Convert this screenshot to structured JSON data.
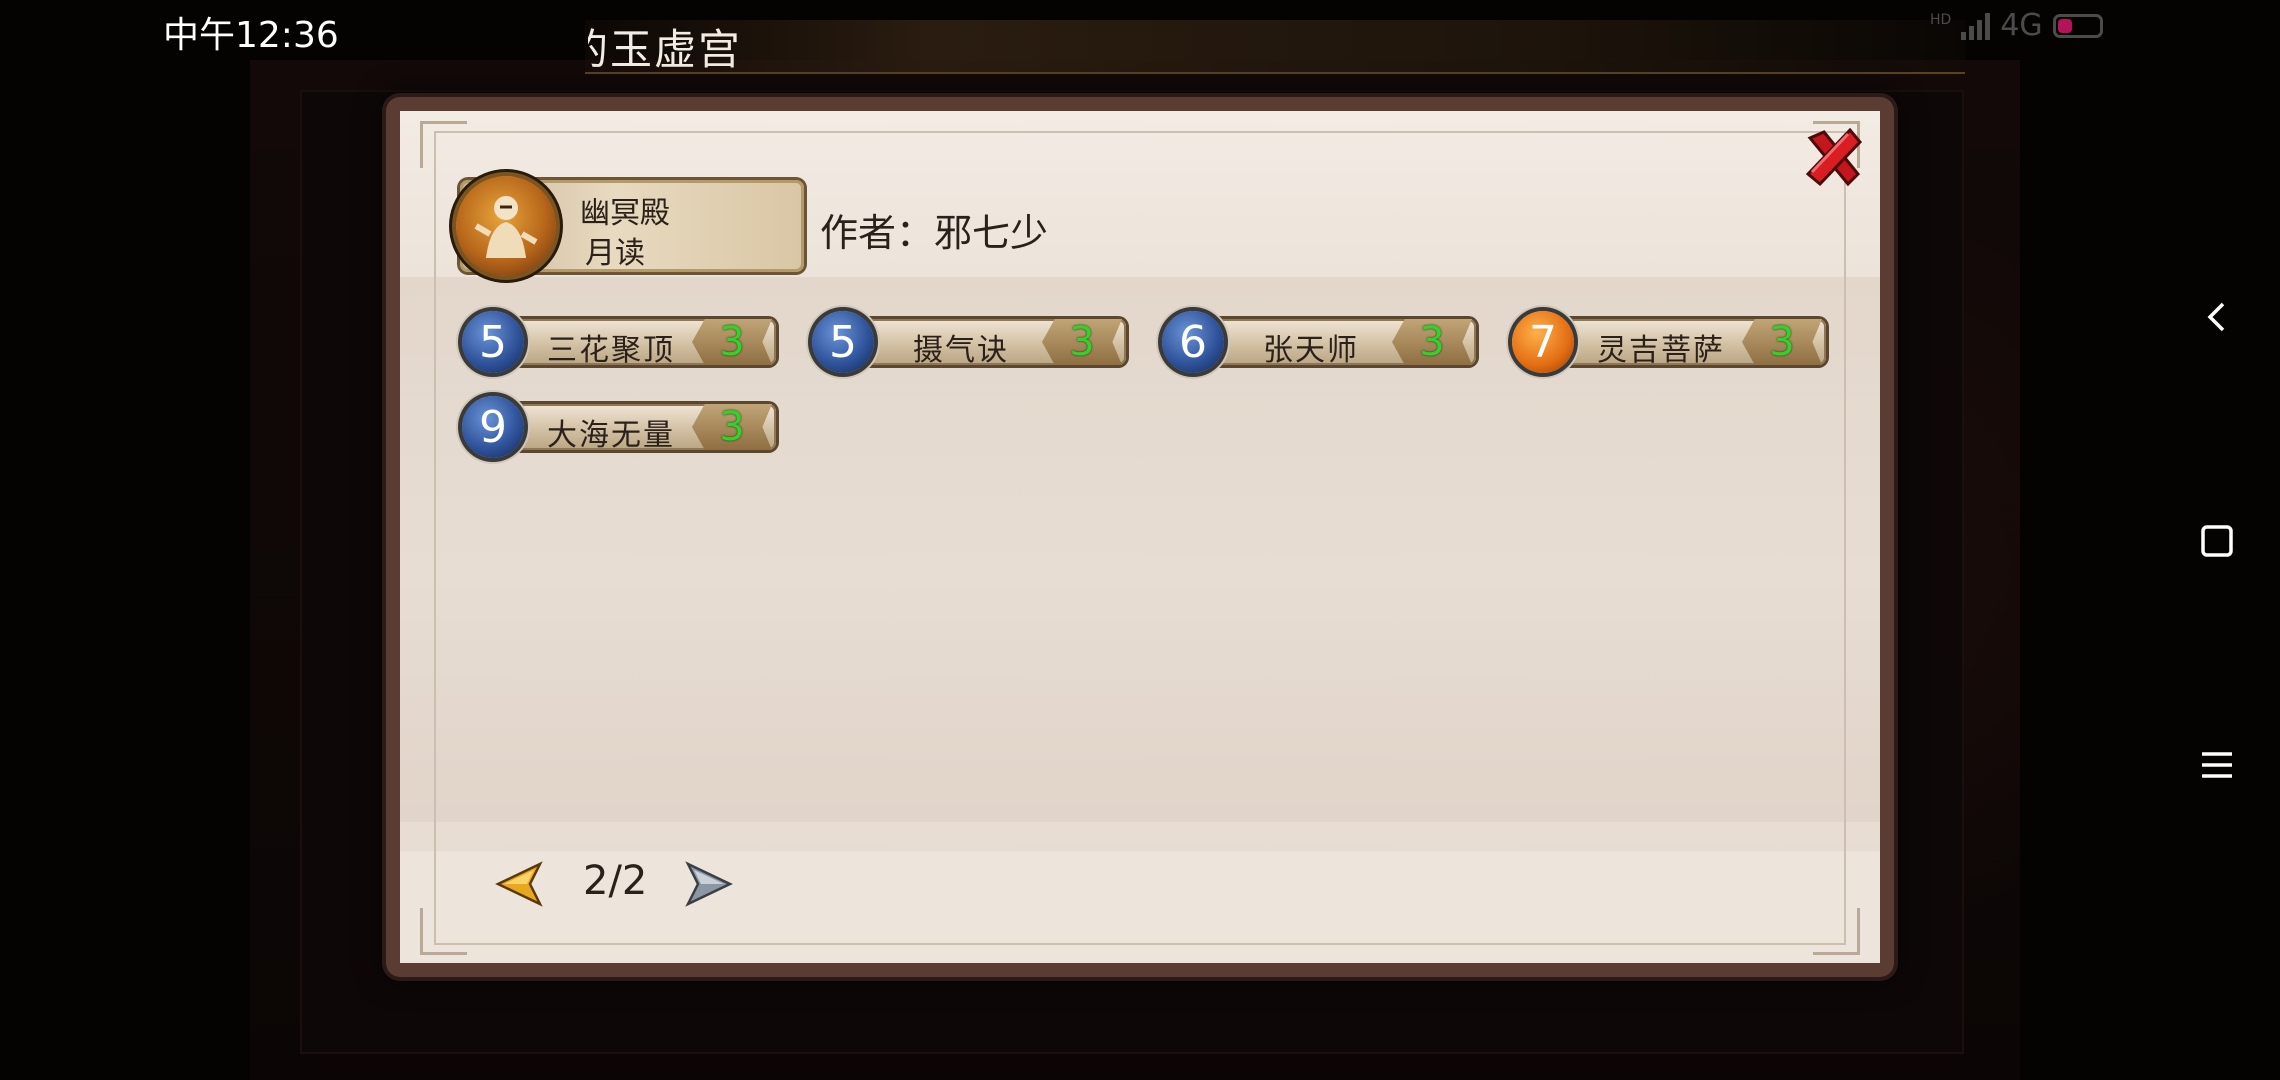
{
  "status_bar": {
    "time": "中午12:36",
    "network": "4G",
    "hd": "HD"
  },
  "background": {
    "title": "玉虚宫",
    "title_prefix": "的"
  },
  "dialog": {
    "sect": {
      "name": "幽冥殿",
      "role": "月读",
      "emblem_icon": "sect-emblem-icon"
    },
    "author_label": "作者：邪七少",
    "skills": [
      {
        "level": "5",
        "name": "三花聚顶",
        "count": "3",
        "level_color": "blue"
      },
      {
        "level": "5",
        "name": "摄气诀",
        "count": "3",
        "level_color": "blue"
      },
      {
        "level": "6",
        "name": "张天师",
        "count": "3",
        "level_color": "blue"
      },
      {
        "level": "7",
        "name": "灵吉菩萨",
        "count": "3",
        "level_color": "orange"
      },
      {
        "level": "9",
        "name": "大海无量",
        "count": "3",
        "level_color": "blue"
      }
    ],
    "pagination": {
      "current": "2/2"
    }
  },
  "colors": {
    "count_green": "#34d12a",
    "level_blue": "#2c4f96",
    "level_orange": "#e36d12",
    "close_red": "#c4161c"
  }
}
